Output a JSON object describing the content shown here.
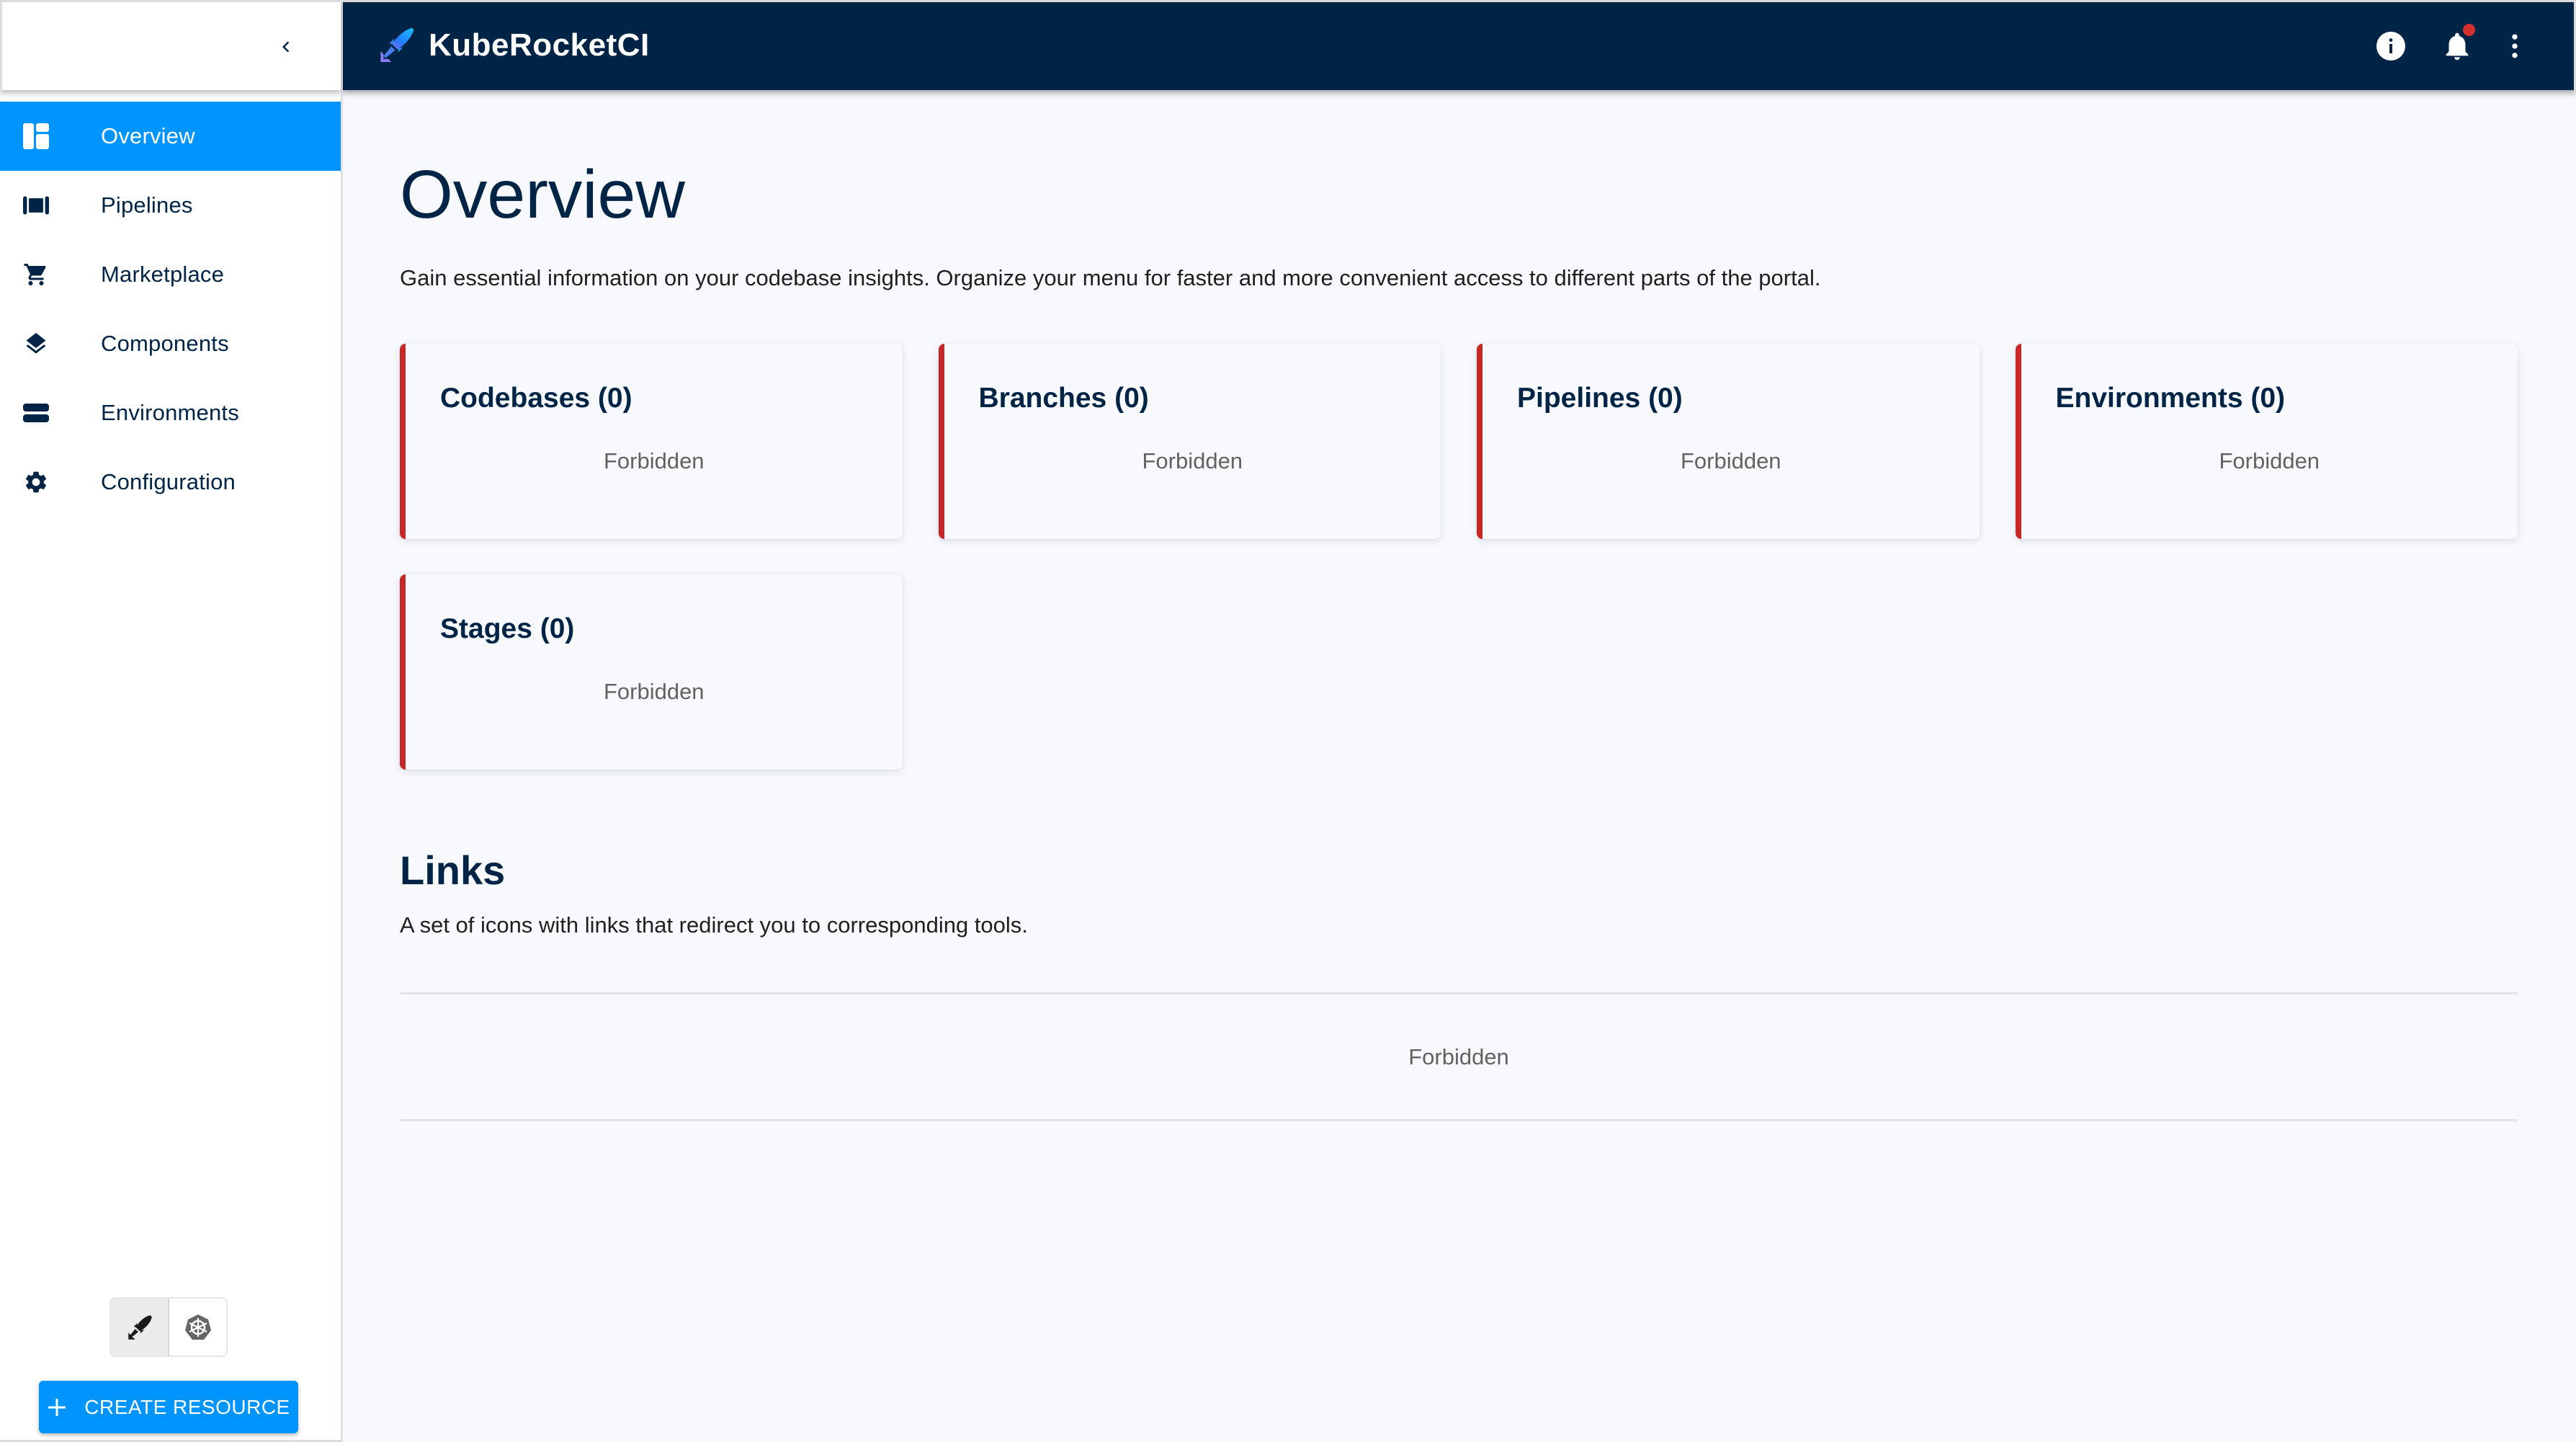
{
  "app": {
    "title": "KubeRocketCI",
    "brand_color": "#002446",
    "accent_color": "#0094ff",
    "error_color": "#c62828"
  },
  "header": {
    "logo_icon": "rocket-logo-icon",
    "icons": [
      {
        "name": "info-icon"
      },
      {
        "name": "notifications-bell-icon",
        "has_badge": true
      },
      {
        "name": "more-vertical-icon"
      }
    ]
  },
  "sidebar": {
    "collapse_icon": "chevron-left-icon",
    "items": [
      {
        "label": "Overview",
        "icon": "dashboard-icon",
        "active": true
      },
      {
        "label": "Pipelines",
        "icon": "pipelines-icon",
        "active": false
      },
      {
        "label": "Marketplace",
        "icon": "cart-icon",
        "active": false
      },
      {
        "label": "Components",
        "icon": "layers-icon",
        "active": false
      },
      {
        "label": "Environments",
        "icon": "environments-icon",
        "active": false
      },
      {
        "label": "Configuration",
        "icon": "gear-icon",
        "active": false
      }
    ],
    "mode_toggle": [
      {
        "name": "krci-mode",
        "icon": "rocket-icon",
        "selected": true
      },
      {
        "name": "kubernetes-mode",
        "icon": "kubernetes-icon",
        "selected": false
      }
    ],
    "create_button": {
      "label": "CREATE RESOURCE",
      "icon": "plus-icon"
    }
  },
  "main": {
    "title": "Overview",
    "description": "Gain essential information on your codebase insights. Organize your menu for faster and more convenient access to different parts of the portal.",
    "cards": [
      {
        "title": "Codebases (0)",
        "status": "Forbidden"
      },
      {
        "title": "Branches (0)",
        "status": "Forbidden"
      },
      {
        "title": "Pipelines (0)",
        "status": "Forbidden"
      },
      {
        "title": "Environments (0)",
        "status": "Forbidden"
      },
      {
        "title": "Stages (0)",
        "status": "Forbidden"
      }
    ],
    "links": {
      "title": "Links",
      "description": "A set of icons with links that redirect you to corresponding tools.",
      "status": "Forbidden"
    }
  }
}
